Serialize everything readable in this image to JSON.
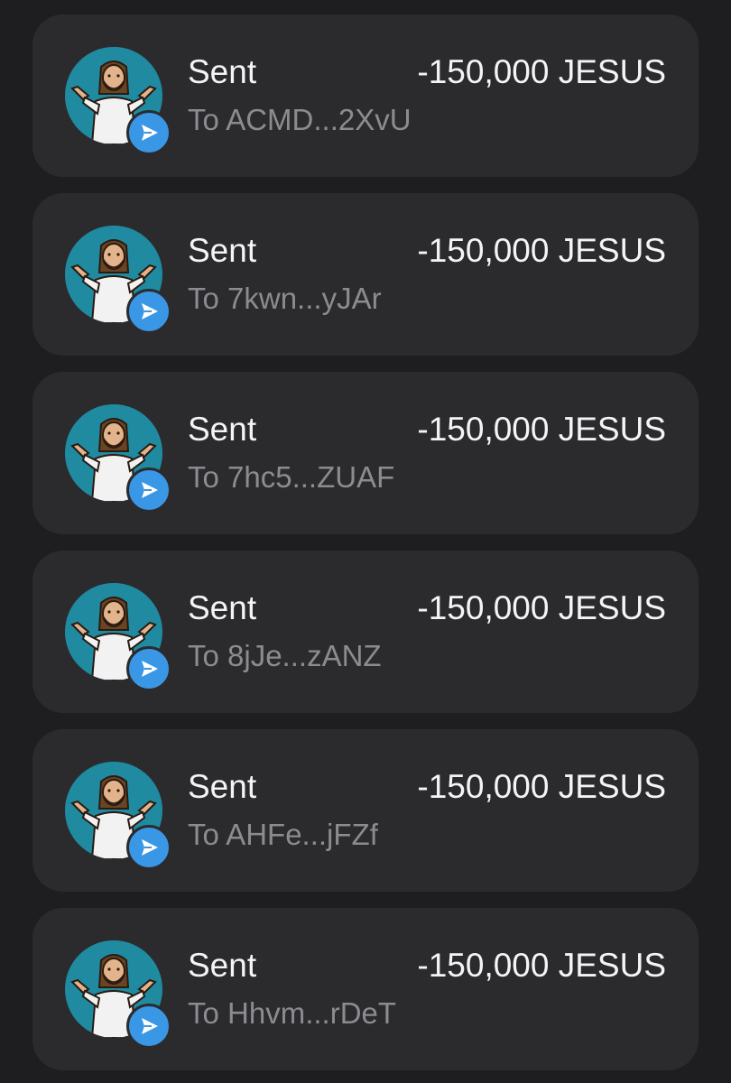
{
  "transactions": [
    {
      "label": "Sent",
      "address": "To ACMD...2XvU",
      "amount": "-150,000 JESUS",
      "icon": "send-arrow-icon"
    },
    {
      "label": "Sent",
      "address": "To 7kwn...yJAr",
      "amount": "-150,000 JESUS",
      "icon": "send-arrow-icon"
    },
    {
      "label": "Sent",
      "address": "To 7hc5...ZUAF",
      "amount": "-150,000 JESUS",
      "icon": "send-arrow-icon"
    },
    {
      "label": "Sent",
      "address": "To 8jJe...zANZ",
      "amount": "-150,000 JESUS",
      "icon": "send-arrow-icon"
    },
    {
      "label": "Sent",
      "address": "To AHFe...jFZf",
      "amount": "-150,000 JESUS",
      "icon": "send-arrow-icon"
    },
    {
      "label": "Sent",
      "address": "To Hhvm...rDeT",
      "amount": "-150,000 JESUS",
      "icon": "send-arrow-icon"
    }
  ],
  "colors": {
    "background": "#1e1e20",
    "card": "#2b2b2e",
    "avatar_bg": "#1f8aa0",
    "send_badge": "#3a97e6",
    "primary_text": "#f4f4f5",
    "secondary_text": "#8b8b90"
  }
}
